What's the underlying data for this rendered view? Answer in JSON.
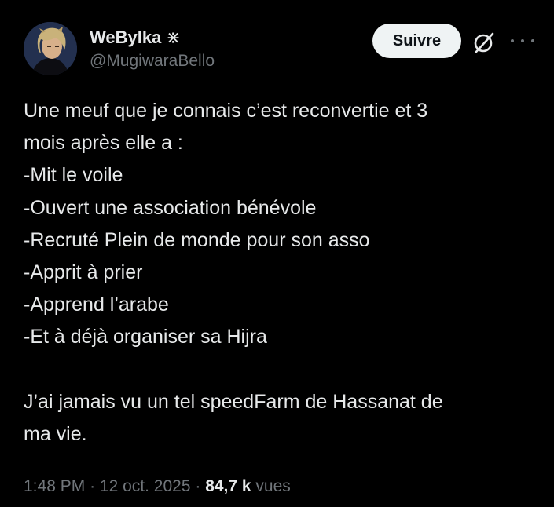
{
  "author": {
    "display_name": "WeBylka",
    "name_glyph": "⋇",
    "handle": "@MugiwaraBello"
  },
  "actions": {
    "follow_label": "Suivre"
  },
  "tweet": {
    "lines": [
      "Une meuf que je connais c’est reconvertie et 3",
      "mois après elle a :",
      "-Mit le voile",
      "-Ouvert une association bénévole",
      "-Recruté Plein de monde pour son asso",
      "-Apprit à prier",
      "-Apprend l’arabe",
      "-Et à déjà organiser sa Hijra",
      "J’ai jamais vu un tel speedFarm de Hassanat de",
      "ma vie."
    ]
  },
  "meta": {
    "time": "1:48 PM",
    "separator": "·",
    "date": "12 oct. 2025",
    "views_count": "84,7 k",
    "views_label": "vues"
  },
  "colors": {
    "background": "#000000",
    "text": "#e7e9ea",
    "muted": "#71767b",
    "button_bg": "#eff3f4"
  }
}
